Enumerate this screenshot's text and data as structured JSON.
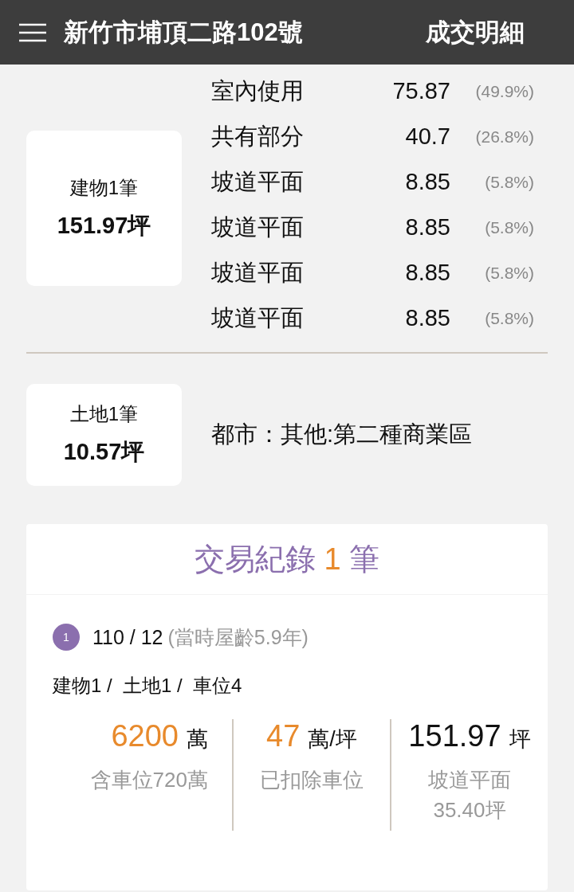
{
  "header": {
    "title": "新竹市埔頂二路102號",
    "section": "成交明細"
  },
  "building": {
    "label": "建物1筆",
    "area": "151.97坪",
    "parts": [
      {
        "name": "室內使用",
        "value": "75.87",
        "percent": "(49.9%)"
      },
      {
        "name": "共有部分",
        "value": "40.7",
        "percent": "(26.8%)"
      },
      {
        "name": "坡道平面",
        "value": "8.85",
        "percent": "(5.8%)"
      },
      {
        "name": "坡道平面",
        "value": "8.85",
        "percent": "(5.8%)"
      },
      {
        "name": "坡道平面",
        "value": "8.85",
        "percent": "(5.8%)"
      },
      {
        "name": "坡道平面",
        "value": "8.85",
        "percent": "(5.8%)"
      }
    ]
  },
  "land": {
    "label": "土地1筆",
    "area": "10.57坪",
    "zoning": "都市：其他:第二種商業區"
  },
  "records": {
    "title": "交易紀錄",
    "count": "1",
    "unit": "筆",
    "items": [
      {
        "index": "1",
        "date": "110 / 12",
        "age": "(當時屋齡5.9年)",
        "summary": "建物1 /  土地1 /  車位4",
        "stats": [
          {
            "value": "6200",
            "unit": "萬",
            "highlight": true,
            "note": [
              "含車位720萬"
            ]
          },
          {
            "value": "47",
            "unit": "萬/坪",
            "highlight": true,
            "note": [
              "已扣除車位"
            ]
          },
          {
            "value": "151.97",
            "unit": "坪",
            "highlight": false,
            "note": [
              "坡道平面",
              "35.40坪"
            ]
          }
        ]
      }
    ]
  }
}
